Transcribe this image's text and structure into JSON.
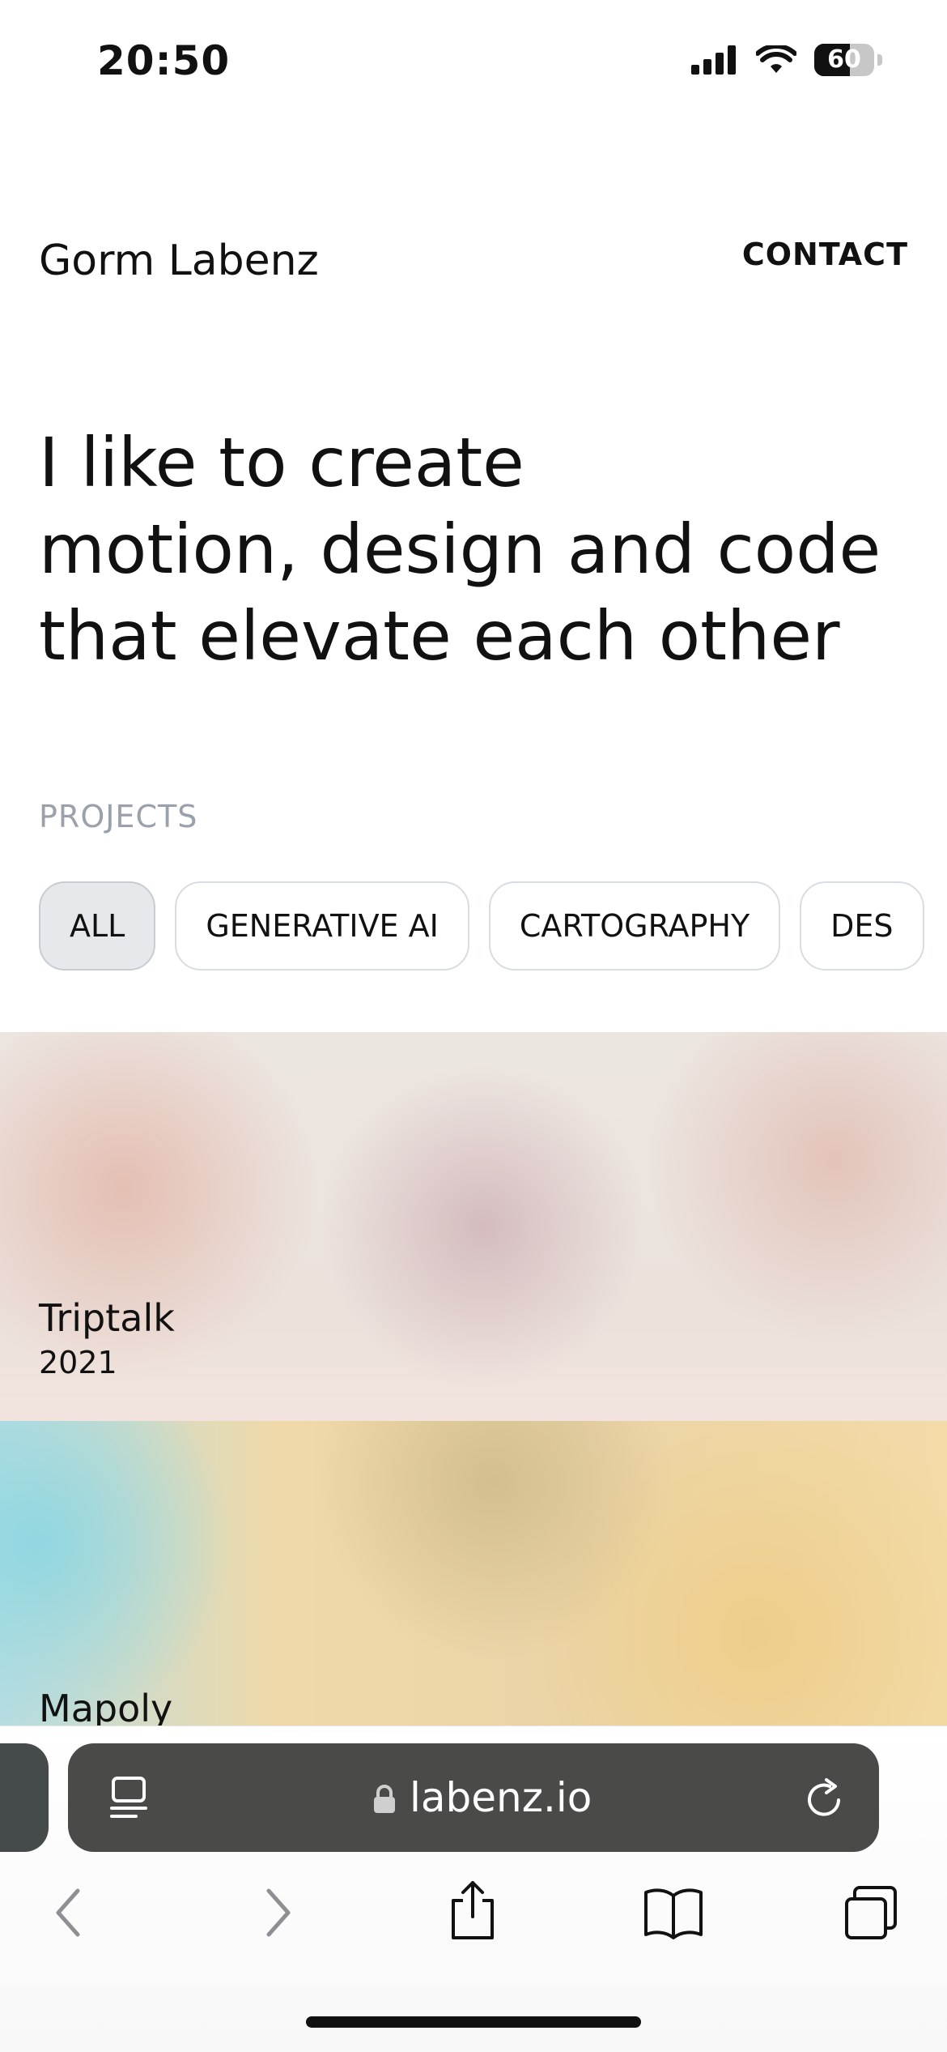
{
  "status_bar": {
    "time": "20:50",
    "battery": "60",
    "battery_level": 0.6
  },
  "header": {
    "site_name": "Gorm Labenz",
    "contact_label": "CONTACT"
  },
  "hero": {
    "lines": [
      "I like to create",
      "motion, design and code",
      "that elevate each other"
    ]
  },
  "projects": {
    "label": "PROJECTS",
    "filters": [
      "ALL",
      "GENERATIVE AI",
      "CARTOGRAPHY",
      "DES"
    ],
    "active_filter": "ALL",
    "items": [
      {
        "title": "Triptalk",
        "year": "2021"
      },
      {
        "title": "Mapoly"
      }
    ]
  },
  "browser": {
    "url": "labenz.io",
    "icons": [
      "reader-icon",
      "lock-icon",
      "reload-icon",
      "back-icon",
      "forward-icon",
      "share-icon",
      "bookmarks-icon",
      "tabs-icon"
    ]
  }
}
